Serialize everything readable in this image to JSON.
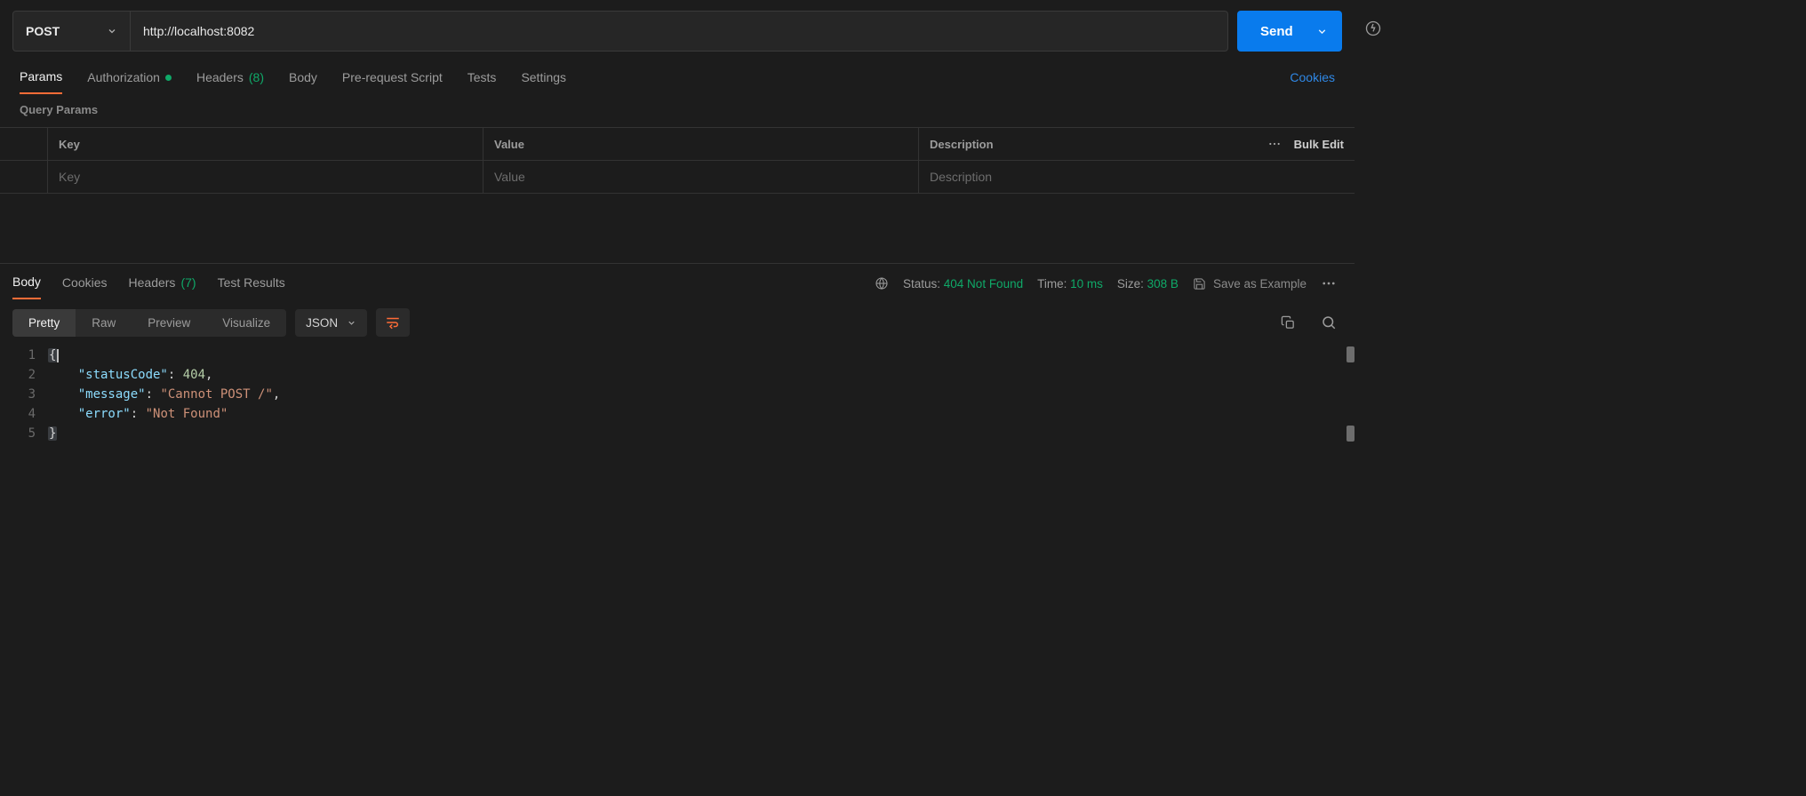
{
  "request": {
    "method": "POST",
    "url": "http://localhost:8082",
    "send_label": "Send"
  },
  "request_tabs": {
    "params": "Params",
    "authorization": "Authorization",
    "headers_label": "Headers",
    "headers_count": "(8)",
    "body": "Body",
    "prerequest": "Pre-request Script",
    "tests": "Tests",
    "settings": "Settings",
    "cookies_link": "Cookies"
  },
  "query_params": {
    "title": "Query Params",
    "columns": {
      "key": "Key",
      "value": "Value",
      "description": "Description"
    },
    "bulk_edit": "Bulk Edit",
    "placeholders": {
      "key": "Key",
      "value": "Value",
      "description": "Description"
    }
  },
  "response_tabs": {
    "body": "Body",
    "cookies": "Cookies",
    "headers_label": "Headers",
    "headers_count": "(7)",
    "test_results": "Test Results"
  },
  "response_meta": {
    "status_label": "Status:",
    "status_value": "404 Not Found",
    "time_label": "Time:",
    "time_value": "10 ms",
    "size_label": "Size:",
    "size_value": "308 B",
    "save_example": "Save as Example"
  },
  "body_view": {
    "pretty": "Pretty",
    "raw": "Raw",
    "preview": "Preview",
    "visualize": "Visualize",
    "format": "JSON"
  },
  "response_body": {
    "statusCode": 404,
    "message": "Cannot POST /",
    "error": "Not Found"
  },
  "code_tokens": {
    "k_statusCode": "\"statusCode\"",
    "v_statusCode": "404",
    "k_message": "\"message\"",
    "v_message": "\"Cannot POST /\"",
    "k_error": "\"error\"",
    "v_error": "\"Not Found\"",
    "brace_open": "{",
    "brace_close": "}",
    "colon": ":",
    "comma": ","
  },
  "line_numbers": [
    "1",
    "2",
    "3",
    "4",
    "5"
  ]
}
